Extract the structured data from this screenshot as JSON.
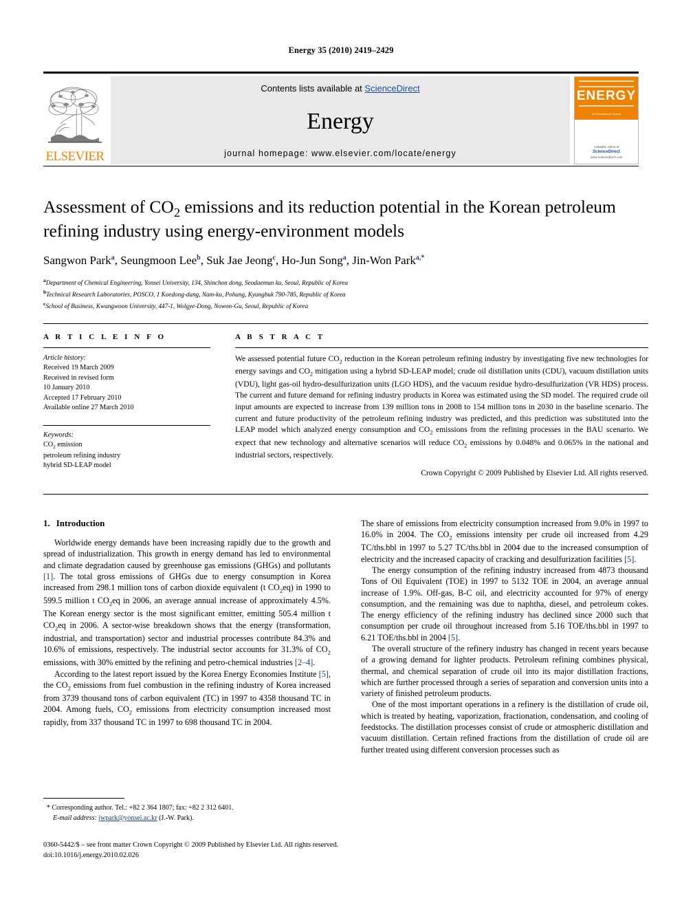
{
  "running_head": "Energy 35 (2010) 2419–2429",
  "journal_header": {
    "publisher_name": "ELSEVIER",
    "contents_prefix": "Contents lists available at ",
    "contents_link": "ScienceDirect",
    "journal_name": "Energy",
    "homepage_line": "journal homepage: www.elsevier.com/locate/energy",
    "cover": {
      "title": "ENERGY",
      "subtitle": "An International Journal",
      "footer_prefix": "Available online at",
      "footer_link": "ScienceDirect",
      "footer_url": "www.sciencedirect.com"
    }
  },
  "article": {
    "title": "Assessment of CO2 emissions and its reduction potential in the Korean petroleum refining industry using energy-environment models",
    "title_line1_pre": "Assessment of CO",
    "title_line1_sub": "2",
    "title_line1_post": " emissions and its reduction potential in the Korean petroleum",
    "title_line2": "refining industry using energy-environment models",
    "authors": [
      {
        "name": "Sangwon Park",
        "marks": "a"
      },
      {
        "name": "Seungmoon Lee",
        "marks": "b"
      },
      {
        "name": "Suk Jae Jeong",
        "marks": "c"
      },
      {
        "name": "Ho-Jun Song",
        "marks": "a"
      },
      {
        "name": "Jin-Won Park",
        "marks": "a,*"
      }
    ],
    "affiliations": [
      {
        "mark": "a",
        "text": "Department of Chemical Engineering, Yonsei University, 134, Shinchon dong, Seodaemun ku, Seoul, Republic of Korea"
      },
      {
        "mark": "b",
        "text": "Technical Research Laboratories, POSCO, 1 Koedong-dang, Nam-ku, Pohang, Kyungbuk 790-785, Republic of Korea"
      },
      {
        "mark": "c",
        "text": "School of Business, Kwangwoon University, 447-1, Wolgye-Dong, Nowon-Gu, Seoul, Republic of Korea"
      }
    ]
  },
  "article_info": {
    "heading": "A R T I C L E   I N F O",
    "history_label": "Article history:",
    "history_lines": [
      "Received 19 March 2009",
      "Received in revised form",
      "10 January 2010",
      "Accepted 17 February 2010",
      "Available online 27 March 2010"
    ],
    "keywords_label": "Keywords:",
    "keywords": [
      "CO2 emission",
      "petroleum refining industry",
      "hybrid SD-LEAP model"
    ]
  },
  "abstract": {
    "heading": "A B S T R A C T",
    "text": "We assessed potential future CO2 reduction in the Korean petroleum refining industry by investigating five new technologies for energy savings and CO2 mitigation using a hybrid SD-LEAP model; crude oil distillation units (CDU), vacuum distillation units (VDU), light gas-oil hydro-desulfurization units (LGO HDS), and the vacuum residue hydro-desulfurization (VR HDS) process. The current and future demand for refining industry products in Korea was estimated using the SD model. The required crude oil input amounts are expected to increase from 139 million tons in 2008 to 154 million tons in 2030 in the baseline scenario. The current and future productivity of the petroleum refining industry was predicted, and this prediction was substituted into the LEAP model which analyzed energy consumption and CO2 emissions from the refining processes in the BAU scenario. We expect that new technology and alternative scenarios will reduce CO2 emissions by 0.048% and 0.065% in the national and industrial sectors, respectively.",
    "copyright": "Crown Copyright © 2009 Published by Elsevier Ltd. All rights reserved."
  },
  "body": {
    "section_number": "1.",
    "section_title": "Introduction",
    "left_paragraphs": [
      "Worldwide energy demands have been increasing rapidly due to the growth and spread of industrialization. This growth in energy demand has led to environmental and climate degradation caused by greenhouse gas emissions (GHGs) and pollutants [1]. The total gross emissions of GHGs due to energy consumption in Korea increased from 298.1 million tons of carbon dioxide equivalent (t CO2eq) in 1990 to 599.5 million t CO2eq in 2006, an average annual increase of approximately 4.5%. The Korean energy sector is the most significant emitter, emitting 505.4 million t CO2eq in 2006. A sector-wise breakdown shows that the energy (transformation, industrial, and transportation) sector and industrial processes contribute 84.3% and 10.6% of emissions, respectively. The industrial sector accounts for 31.3% of CO2 emissions, with 30% emitted by the refining and petro-chemical industries [2–4].",
      "According to the latest report issued by the Korea Energy Economies Institute [5], the CO2 emissions from fuel combustion in the refining industry of Korea increased from 3739 thousand tons of carbon equivalent (TC) in 1997 to 4358 thousand TC in 2004. Among fuels, CO2 emissions from electricity consumption increased most rapidly, from 337 thousand TC in 1997 to 698 thousand TC in 2004."
    ],
    "right_paragraphs": [
      "The share of emissions from electricity consumption increased from 9.0% in 1997 to 16.0% in 2004. The CO2 emissions intensity per crude oil increased from 4.29 TC/ths.bbl in 1997 to 5.27 TC/ths.bbl in 2004 due to the increased consumption of electricity and the increased capacity of cracking and desulfurization facilities [5].",
      "The energy consumption of the refining industry increased from 4873 thousand Tons of Oil Equivalent (TOE) in 1997 to 5132 TOE in 2004, an average annual increase of 1.9%. Off-gas, B-C oil, and electricity accounted for 97% of energy consumption, and the remaining was due to naphtha, diesel, and petroleum cokes. The energy efficiency of the refining industry has declined since 2000 such that consumption per crude oil throughout increased from 5.16 TOE/ths.bbl in 1997 to 6.21 TOE/ths.bbl in 2004 [5].",
      "The overall structure of the refinery industry has changed in recent years because of a growing demand for lighter products. Petroleum refining combines physical, thermal, and chemical separation of crude oil into its major distillation fractions, which are further processed through a series of separation and conversion units into a variety of finished petroleum products.",
      "One of the most important operations in a refinery is the distillation of crude oil, which is treated by heating, vaporization, fractionation, condensation, and cooling of feedstocks. The distillation processes consist of crude or atmospheric distillation and vacuum distillation. Certain refined fractions from the distillation of crude oil are further treated using different conversion processes such as"
    ]
  },
  "footnote": {
    "corresponding": "* Corresponding author. Tel.: +82 2 364 1807; fax: +82 2 312 6401.",
    "email_label": "E-mail address:",
    "email": "jwpark@yonsei.ac.kr",
    "email_suffix": "(J.-W. Park)."
  },
  "colophon": {
    "line1": "0360-5442/$ – see front matter Crown Copyright © 2009 Published by Elsevier Ltd. All rights reserved.",
    "line2": "doi:10.1016/j.energy.2010.02.026"
  },
  "colors": {
    "elsevier_orange": "#ef8200",
    "link_blue": "#1a4fa0",
    "ref_blue": "#1a3a7a",
    "banner_grey": "#e9e9e9"
  }
}
